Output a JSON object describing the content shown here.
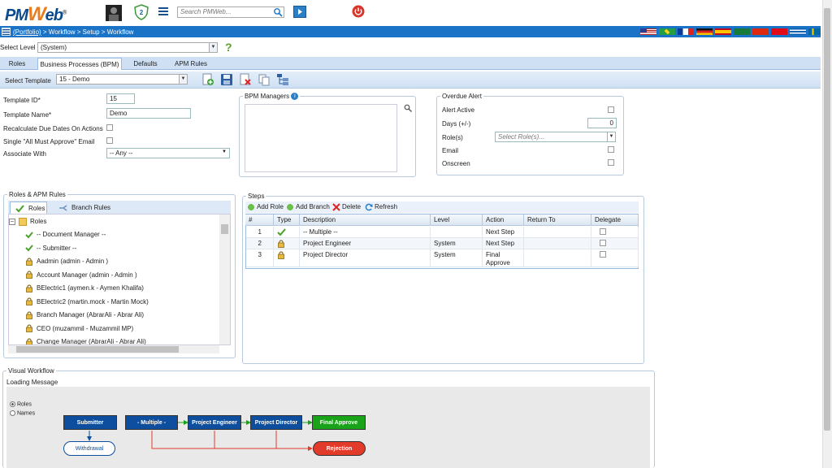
{
  "header": {
    "logo_pm": "PM",
    "logo_w": "W",
    "logo_eb": "eb",
    "logo_tm": "®",
    "badge_count": "2",
    "search_placeholder": "Search PMWeb..."
  },
  "nav": {
    "breadcrumb_link": "(Portfolio)",
    "breadcrumb_rest": " > Workflow > Setup > Workflow"
  },
  "level": {
    "label": "Select Level",
    "value": "(System)"
  },
  "tabs": [
    {
      "label": "Roles"
    },
    {
      "label": "Business Processes (BPM)"
    },
    {
      "label": "Defaults"
    },
    {
      "label": "APM Rules"
    }
  ],
  "template": {
    "label": "Select Template",
    "value": "15 - Demo"
  },
  "form": {
    "template_id_label": "Template ID*",
    "template_id_value": "15",
    "template_name_label": "Template Name*",
    "template_name_value": "Demo",
    "recalc_label": "Recalculate Due Dates On Actions",
    "single_email_label": "Single \"All Must Approve\" Email",
    "associate_label": "Associate With",
    "associate_value": "-- Any --"
  },
  "bpm_managers": {
    "legend": "BPM Managers"
  },
  "overdue": {
    "legend": "Overdue Alert",
    "alert_active_label": "Alert Active",
    "days_label": "Days (+/-)",
    "days_value": "0",
    "roles_label": "Role(s)",
    "roles_placeholder": "Select Role(s)...",
    "email_label": "Email",
    "onscreen_label": "Onscreen"
  },
  "roles_panel": {
    "legend": "Roles & APM Rules",
    "tab_roles": "Roles",
    "tab_branch": "Branch Rules",
    "root": "Roles",
    "items": [
      {
        "label": "-- Document Manager --",
        "icon": "check"
      },
      {
        "label": "-- Submitter --",
        "icon": "check"
      },
      {
        "label": "Aadmin (admin - Admin )",
        "icon": "lock"
      },
      {
        "label": "Account Manager (admin - Admin )",
        "icon": "lock"
      },
      {
        "label": "BElectric1 (aymen.k - Aymen Khalifa)",
        "icon": "lock"
      },
      {
        "label": "BElectric2 (martin.mock - Martin Mock)",
        "icon": "lock"
      },
      {
        "label": "Branch Manager (AbrarAli - Abrar Ali)",
        "icon": "lock"
      },
      {
        "label": "CEO (muzammil - Muzammil MP)",
        "icon": "lock"
      },
      {
        "label": "Change Manager (AbrarAli - Abrar Ali)",
        "icon": "lock"
      }
    ]
  },
  "steps": {
    "legend": "Steps",
    "add_role": "Add Role",
    "add_branch": "Add Branch",
    "delete": "Delete",
    "refresh": "Refresh",
    "columns": [
      "#",
      "Type",
      "Description",
      "Level",
      "Action",
      "Return To",
      "Delegate"
    ],
    "rows": [
      {
        "num": "1",
        "type": "check",
        "description": "-- Multiple --",
        "level": "",
        "action": "Next Step",
        "return_to": ""
      },
      {
        "num": "2",
        "type": "lock",
        "description": "Project Engineer",
        "level": "System",
        "action": "Next Step",
        "return_to": ""
      },
      {
        "num": "3",
        "type": "lock",
        "description": "Project Director",
        "level": "System",
        "action_line1": "Final",
        "action_line2": "Approve",
        "return_to": ""
      }
    ]
  },
  "visual": {
    "legend": "Visual Workflow",
    "loading": "Loading Message",
    "radio_roles": "Roles",
    "radio_names": "Names",
    "nodes": {
      "submitter": "Submitter",
      "withdrawal": "Withdrawal",
      "multiple": "- Multiple -",
      "engineer": "Project Engineer",
      "director": "Project Director",
      "final": "Final Approve",
      "rejection": "Rejection"
    }
  },
  "colors": {
    "brand_blue": "#1b73c8",
    "node_blue": "#0d4f9e",
    "node_green": "#18a318",
    "node_red": "#e23b2a"
  }
}
